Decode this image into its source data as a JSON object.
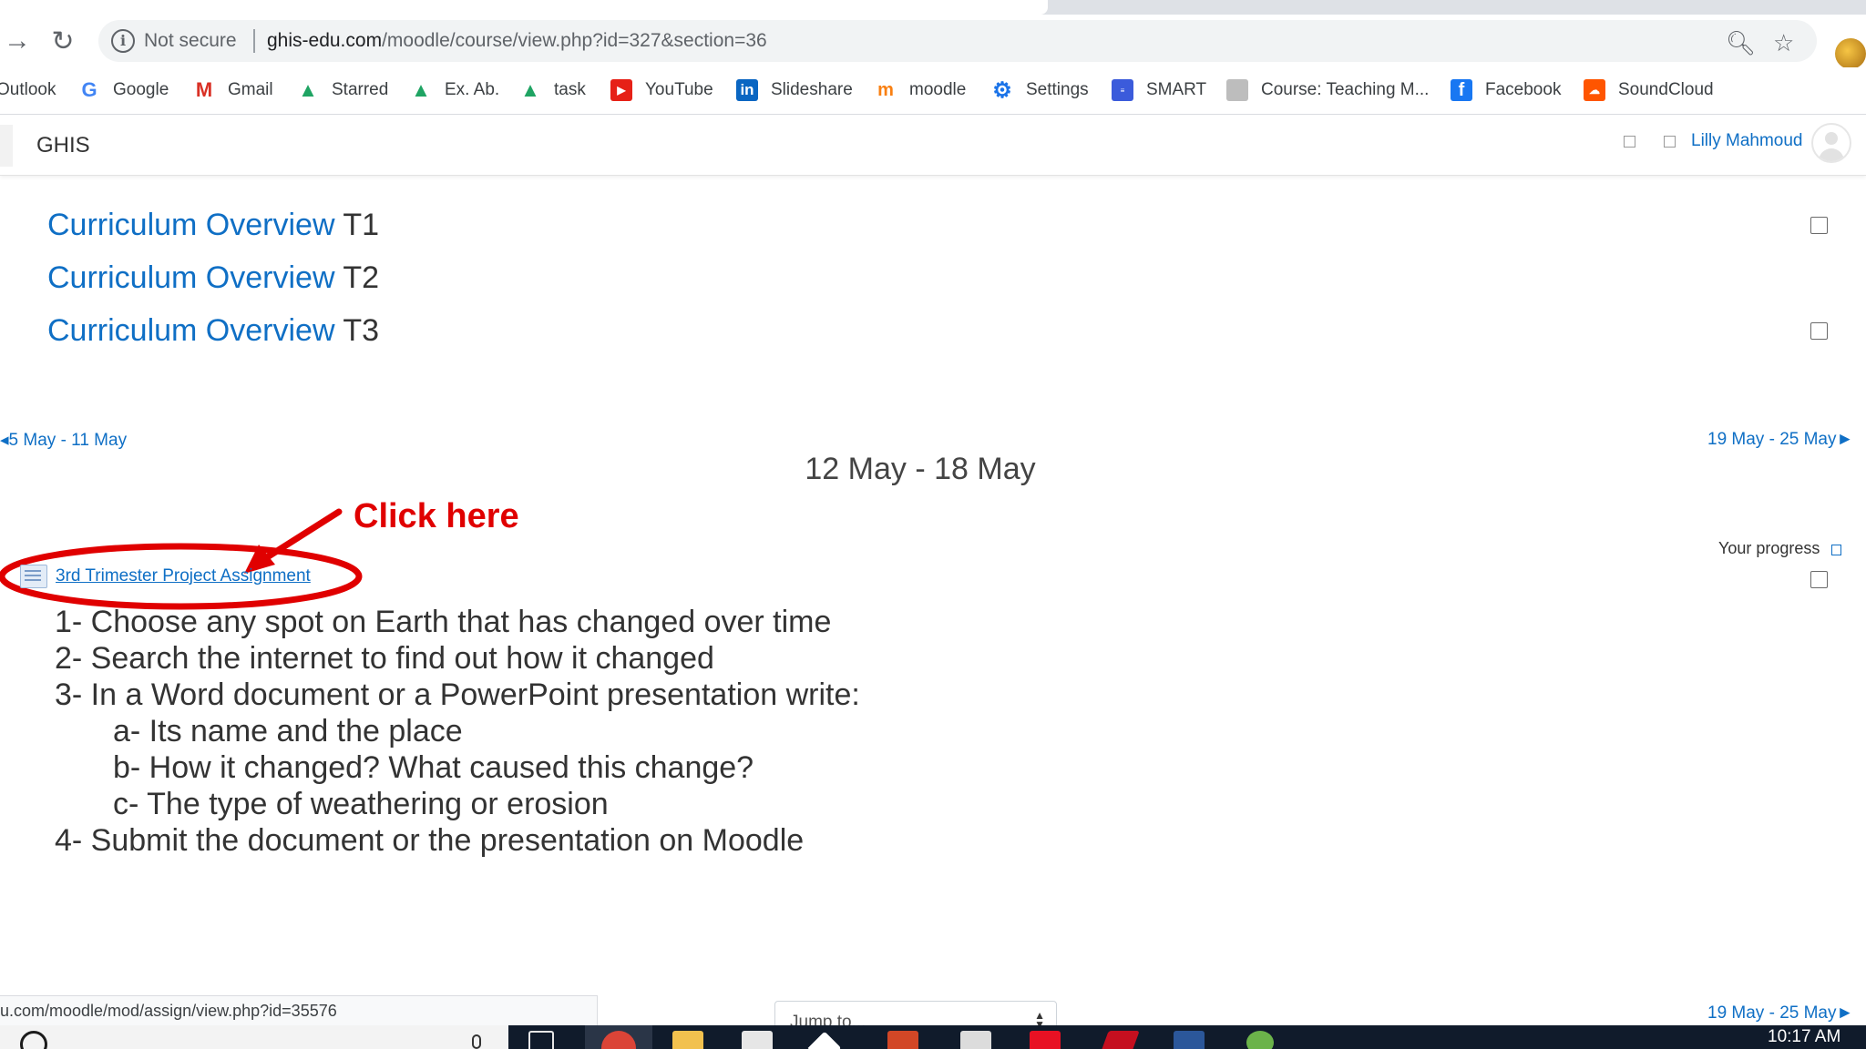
{
  "browser": {
    "security_label": "Not secure",
    "url_host": "ghis-edu.com",
    "url_path": "/moodle/course/view.php?id=327&section=36",
    "bookmarks": [
      {
        "label": "Outlook",
        "icon": "outlook-icon"
      },
      {
        "label": "Google",
        "icon": "google-icon"
      },
      {
        "label": "Gmail",
        "icon": "gmail-icon"
      },
      {
        "label": "Starred",
        "icon": "drive-icon"
      },
      {
        "label": "Ex. Ab.",
        "icon": "drive-icon"
      },
      {
        "label": "task",
        "icon": "drive-icon"
      },
      {
        "label": "YouTube",
        "icon": "youtube-icon"
      },
      {
        "label": "Slideshare",
        "icon": "linkedin-icon"
      },
      {
        "label": "moodle",
        "icon": "moodle-icon"
      },
      {
        "label": "Settings",
        "icon": "gear-icon"
      },
      {
        "label": "SMART",
        "icon": "smart-icon"
      },
      {
        "label": "Course: Teaching M...",
        "icon": "moodle-course-icon"
      },
      {
        "label": "Facebook",
        "icon": "facebook-icon"
      },
      {
        "label": "SoundCloud",
        "icon": "soundcloud-icon"
      }
    ],
    "status_url": "u.com/moodle/mod/assign/view.php?id=35576"
  },
  "moodle_nav": {
    "site_name": "GHIS",
    "user_name": "Lilly Mahmoud"
  },
  "overview_links": [
    {
      "link": "Curriculum Overview",
      "suffix": "T1"
    },
    {
      "link": "Curriculum Overview",
      "suffix": "T2"
    },
    {
      "link": "Curriculum Overview",
      "suffix": "T3"
    }
  ],
  "section": {
    "prev_week": "5 May - 11 May",
    "next_week": "19 May - 25 May",
    "title": "12 May - 18 May",
    "progress_label": "Your progress",
    "assignment_name": "3rd Trimester Project Assignment",
    "instructions": [
      "1- Choose any spot on Earth that has changed over time",
      "2- Search the internet to find out how it changed",
      "3- In a Word document or a PowerPoint presentation write:",
      "a- Its name and the place",
      "b- How it changed? What caused this change?",
      "c- The type of weathering or erosion",
      "4- Submit the document or the presentation on Moodle"
    ]
  },
  "annotation": {
    "text": "Click here",
    "color": "#e00000"
  },
  "footer": {
    "jump_to_placeholder": "Jump to...",
    "next_week": "19 May - 25 May"
  },
  "taskbar": {
    "time": "10:17 AM"
  },
  "colors": {
    "link_blue": "#0f6fc5",
    "taskbar_bg": "#101b2b"
  }
}
